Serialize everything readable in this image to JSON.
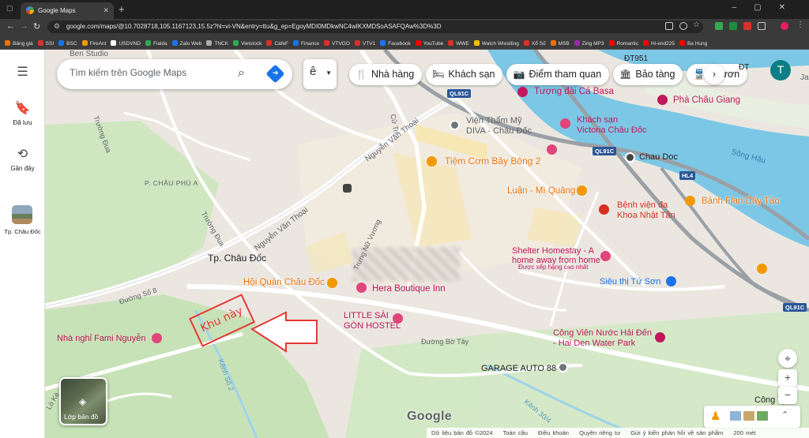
{
  "browser": {
    "tab_title": "Google Maps",
    "url": "google.com/maps/@10.7028718,105.1167123,15.5z?hl=vi-VN&entry=ttu&g_ep=EgoyMDI0MDkwNC4wIKXMDSoASAFQAw%3D%3D",
    "bookmarks": [
      {
        "label": "Bảng giá",
        "color": "#e8710a"
      },
      {
        "label": "SSI",
        "color": "#d93025"
      },
      {
        "label": "BSC",
        "color": "#1a73e8"
      },
      {
        "label": "FireAnt",
        "color": "#f29900"
      },
      {
        "label": "USDVND",
        "color": "#ffffff"
      },
      {
        "label": "Fialda",
        "color": "#34a853"
      },
      {
        "label": "Zalo Web",
        "color": "#1a73e8"
      },
      {
        "label": "TNCK",
        "color": "#aaaaaa"
      },
      {
        "label": "Vietstock",
        "color": "#34a853"
      },
      {
        "label": "CafeF",
        "color": "#d93025"
      },
      {
        "label": "Finance",
        "color": "#1a73e8"
      },
      {
        "label": "VTVGO",
        "color": "#d93025"
      },
      {
        "label": "VTV1",
        "color": "#d93025"
      },
      {
        "label": "Facebook",
        "color": "#1877f2"
      },
      {
        "label": "YouTube",
        "color": "#ff0000"
      },
      {
        "label": "WWE",
        "color": "#d93025"
      },
      {
        "label": "Watch Wrestling",
        "color": "#fbbc04"
      },
      {
        "label": "Xổ Số",
        "color": "#d93025"
      },
      {
        "label": "MSB",
        "color": "#e8710a"
      },
      {
        "label": "Zing MP3",
        "color": "#9c27b0"
      },
      {
        "label": "Romantic",
        "color": "#ff0000"
      },
      {
        "label": "Hi-end225",
        "color": "#ff0000"
      },
      {
        "label": "Ba Hung",
        "color": "#ff0000"
      }
    ]
  },
  "sidebar": {
    "saved": "Đã lưu",
    "recent": "Gần đây",
    "place": "Tp. Châu Đốc"
  },
  "search": {
    "placeholder": "Tìm kiếm trên Google Maps",
    "ime": "ê"
  },
  "chips": [
    {
      "icon": "utensils-icon",
      "glyph": "🍴",
      "label": "Nhà hàng"
    },
    {
      "icon": "bed-icon",
      "glyph": "🛏",
      "label": "Khách sạn"
    },
    {
      "icon": "camera-icon",
      "glyph": "📷",
      "label": "Điểm tham quan"
    },
    {
      "icon": "museum-icon",
      "glyph": "🏛",
      "label": "Bảo tàng"
    },
    {
      "icon": "transit-icon",
      "glyph": "🚆",
      "label": "Phươn"
    }
  ],
  "avatar_letter": "T",
  "map": {
    "labels": {
      "ben_studio": "Ben Studio",
      "dt951": "ĐT951",
      "dt_right": "ĐT",
      "ja": "Ja",
      "truong_dua": "Trường Đua",
      "cu_tri": "Cử Tri",
      "nguyen_van_thoai_1": "Nguyễn Văn Thoại",
      "nguyen_van_thoai_2": "Nguyễn Văn Thoại",
      "p_chau_phu_a": "P. CHÂU PHÚ A",
      "truong_dua_2": "Trường Đua",
      "tp_chau_doc": "Tp. Châu Đốc",
      "truong_nu": "Trưng Nữ Vương",
      "duong_so_8": "Đường Số 8",
      "duong_bo_tay": "Đường Bờ Tây",
      "kenh_so_2": "Kênh Số 2",
      "kenh_30_4": "Kênh 30/4",
      "lo_ken": "Lò Kè",
      "ql91c_1": "QL91C",
      "ql91c_2": "QL91C",
      "ql91c_3": "QL91C",
      "hl4": "HL4",
      "song_hau": "Sông Hậu",
      "chau_doc_ferry": "Chau Doc",
      "tuong_dai": "Tượng đài Cá Basa",
      "phu_chau_giang": "Phà Châu Giang",
      "vien_tham_my": "Viện Thẩm Mỹ\nDIVA - Châu Đốc",
      "khach_san_victoria": "Khách sạn\nVictoria Châu Đốc",
      "tiem_com": "Tiệm Cơm Bảy Bông 2",
      "luan_mi_quang": "Luận - Mì Quảng",
      "benh_vien": "Bệnh viện đa\nKhoa Nhật Tân",
      "banh_flan": "Bánh Flan Cây Táo",
      "shelter": "Shelter Homestay - A\nhome away from home",
      "shelter_note": "Được xếp hạng cao nhất",
      "sieu_thi": "Siêu thị Tứ Sơn",
      "hoi_quan": "Hội Quán Châu Đốc",
      "hera": "Hera Boutique Inn",
      "little_saigon": "LITTLE SÀI\nGÒN HOSTEL",
      "fami": "Nhà nghỉ Fami Nguyễn",
      "cong_vien": "Công Viên Nước Hải Đến\n- Hai Den Water Park",
      "garage": "GARAGE AUTO 88",
      "cong_ty": "Công Ty C"
    },
    "annotation": "Khu này",
    "annotation_color": "#e53935",
    "layer_label": "Lớp bản đồ",
    "google": "Google",
    "footer": {
      "data": "Dữ liệu bản đồ ©2024",
      "global": "Toàn cầu",
      "terms": "Điều khoản",
      "privacy": "Quyền riêng tư",
      "feedback": "Gửi ý kiến phản hồi về sản phẩm",
      "scale": "200 mét"
    }
  }
}
